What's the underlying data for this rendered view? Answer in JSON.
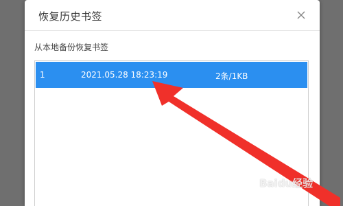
{
  "dialog": {
    "title": "恢复历史书签",
    "close_icon": "close-icon",
    "subtitle": "从本地备份恢复书签"
  },
  "backups": [
    {
      "index": "1",
      "datetime": "2021.05.28 18:23:19",
      "size": "2条/1KB",
      "selected": true
    }
  ],
  "colors": {
    "selected_row": "#2b8ff0",
    "annotation_arrow": "#f0302a"
  },
  "watermark": "Baidu经验"
}
